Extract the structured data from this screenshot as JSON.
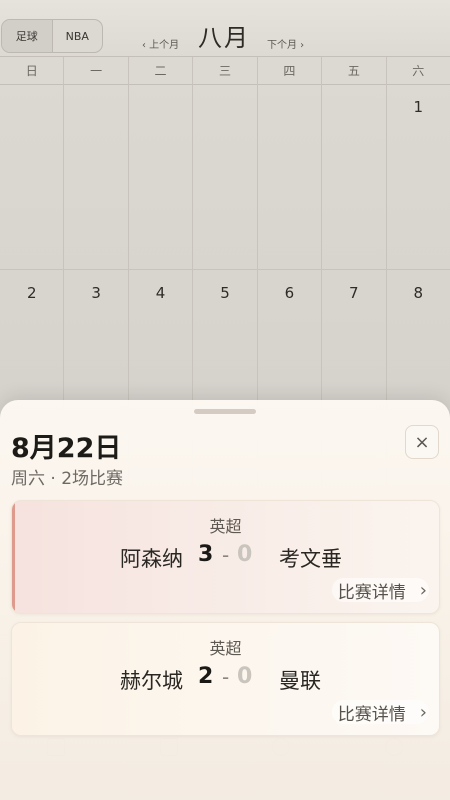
{
  "header": {
    "tabs": [
      "足球",
      "NBA"
    ],
    "prev_month": "‹ 上个月",
    "month": "八月",
    "next_month": "下个月 ›"
  },
  "weekdays": [
    "日",
    "一",
    "二",
    "三",
    "四",
    "五",
    "六"
  ],
  "calendar": {
    "week1": [
      "",
      "",
      "",
      "",
      "",
      "",
      "1"
    ],
    "week2": [
      "2",
      "3",
      "4",
      "5",
      "6",
      "7",
      "8"
    ]
  },
  "sheet": {
    "date": "8月22日",
    "subtitle": "周六 · 2场比赛",
    "close": "×",
    "matches": [
      {
        "league": "英超",
        "home": "阿森纳",
        "home_score": "3",
        "dash": "-",
        "away_score": "0",
        "away": "考文垂",
        "details": "比赛详情",
        "chevron": "›"
      },
      {
        "league": "英超",
        "home": "赫尔城",
        "home_score": "2",
        "dash": "-",
        "away_score": "0",
        "away": "曼联",
        "details": "比赛详情",
        "chevron": "›"
      }
    ]
  },
  "colors": {
    "accent_first_card": "#de9a8c",
    "sheet_bg": "#fbf5ee"
  }
}
